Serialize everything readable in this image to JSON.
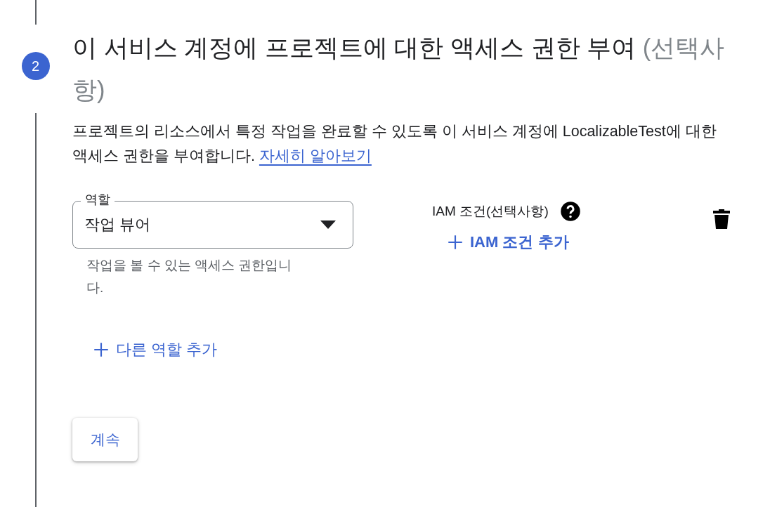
{
  "step": {
    "number": "2",
    "title": "이 서비스 계정에 프로젝트에 대한 액세스 권한 부여",
    "optional": "(선택사항)"
  },
  "description": {
    "text": "프로젝트의 리소스에서 특정 작업을 완료할 수 있도록 이 서비스 계정에 LocalizableTest에 대한 액세스 권한을 부여합니다.",
    "link": "자세히 알아보기"
  },
  "role": {
    "label": "역할",
    "value": "작업 뷰어",
    "helper": "작업을 볼 수 있는 액세스 권한입니다."
  },
  "condition": {
    "label": "IAM 조건(선택사항)",
    "add_button": "IAM 조건 추가"
  },
  "add_role_button": "다른 역할 추가",
  "continue_button": "계속"
}
